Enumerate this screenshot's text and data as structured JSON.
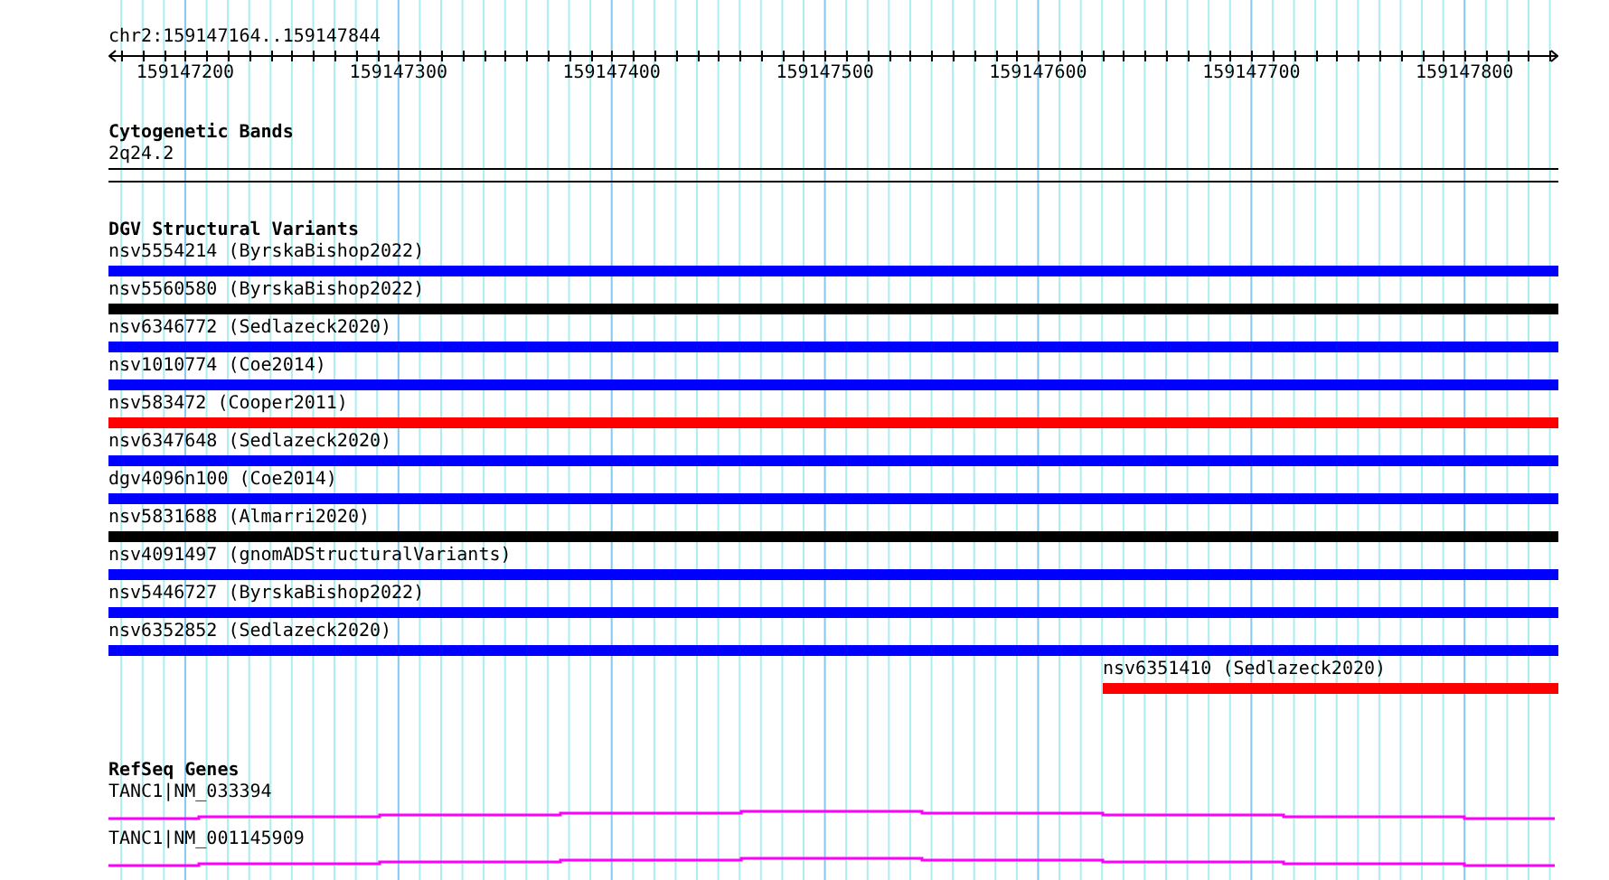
{
  "region": "chr2:159147164..159147844",
  "ruler": {
    "labels": [
      "159147200",
      "159147300",
      "159147400",
      "159147500",
      "159147600",
      "159147700",
      "159147800"
    ]
  },
  "cytogenetic_bands": {
    "title": "Cytogenetic Bands",
    "band": "2q24.2"
  },
  "dgv_structural_variants": {
    "title": "DGV Structural Variants",
    "features": [
      {
        "label": "nsv5554214 (ByrskaBishop2022)",
        "color": "#0000ff",
        "kind": "spanning"
      },
      {
        "label": "nsv5560580 (ByrskaBishop2022)",
        "color": "#000000",
        "kind": "spanning"
      },
      {
        "label": "nsv6346772 (Sedlazeck2020)",
        "color": "#0000ff",
        "kind": "spanning"
      },
      {
        "label": "nsv1010774 (Coe2014)",
        "color": "#0000ff",
        "kind": "spanning"
      },
      {
        "label": "nsv583472 (Cooper2011)",
        "color": "#ff0000",
        "kind": "spanning"
      },
      {
        "label": "nsv6347648 (Sedlazeck2020)",
        "color": "#0000ff",
        "kind": "spanning"
      },
      {
        "label": "dgv4096n100 (Coe2014)",
        "color": "#0000ff",
        "kind": "spanning"
      },
      {
        "label": "nsv5831688 (Almarri2020)",
        "color": "#000000",
        "kind": "spanning"
      },
      {
        "label": "nsv4091497 (gnomADStructuralVariants)",
        "color": "#0000ff",
        "kind": "spanning"
      },
      {
        "label": "nsv5446727 (ByrskaBishop2022)",
        "color": "#0000ff",
        "kind": "spanning"
      },
      {
        "label": "nsv6352852 (Sedlazeck2020)",
        "color": "#0000ff",
        "kind": "spanning"
      },
      {
        "label": "nsv6351410 (Sedlazeck2020)",
        "color": "#ff0000",
        "kind": "right_end"
      }
    ]
  },
  "refseq_genes": {
    "title": "RefSeq Genes",
    "genes": [
      {
        "label": "TANC1|NM_033394"
      },
      {
        "label": "TANC1|NM_001145909"
      }
    ]
  }
}
